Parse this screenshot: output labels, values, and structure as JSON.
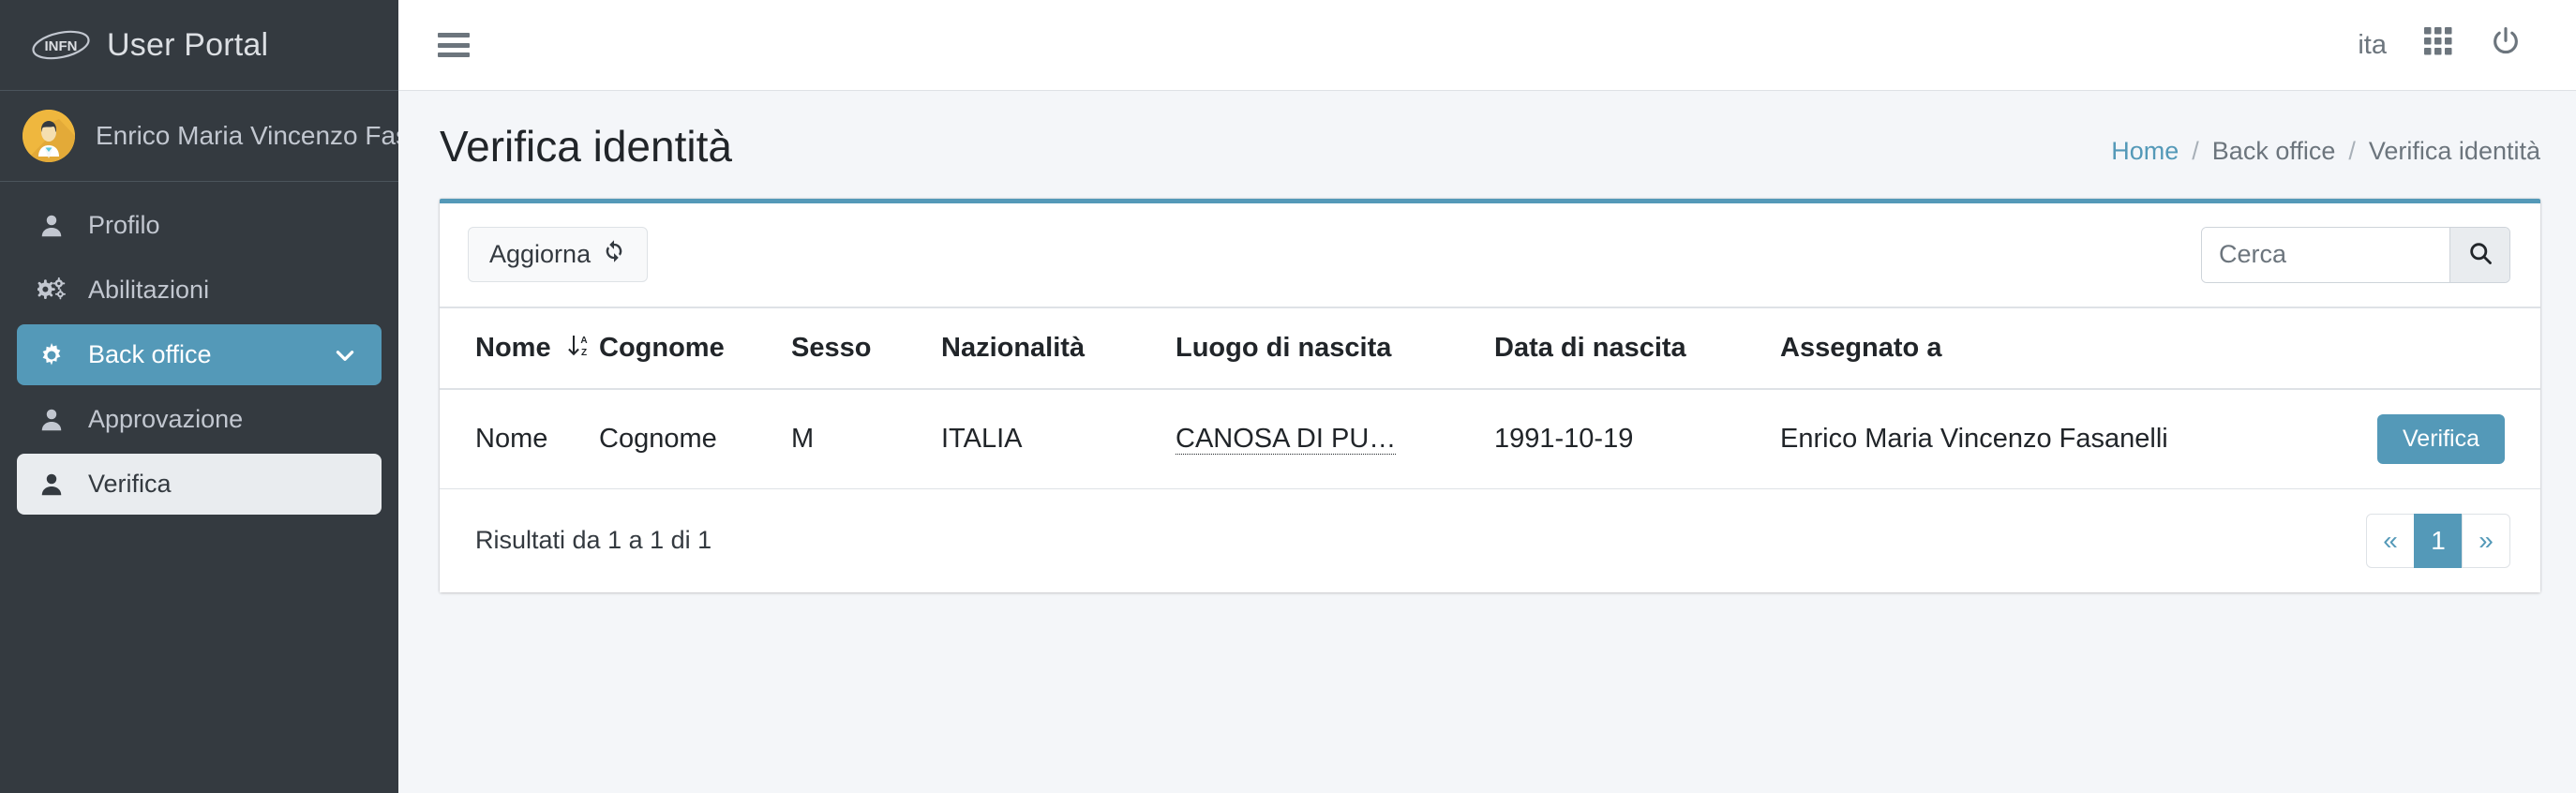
{
  "brand": {
    "logo_text": "INFN",
    "title": "User Portal"
  },
  "user": {
    "name": "Enrico Maria Vincenzo Fasanelli",
    "avatar_icon": "user-avatar"
  },
  "sidebar": {
    "items": [
      {
        "label": "Profilo",
        "icon": "user-icon",
        "state": "default"
      },
      {
        "label": "Abilitazioni",
        "icon": "gears-icon",
        "state": "default"
      },
      {
        "label": "Back office",
        "icon": "gear-icon",
        "state": "active",
        "chevron": "chevron-down-icon"
      },
      {
        "label": "Approvazione",
        "icon": "user-icon",
        "state": "default"
      },
      {
        "label": "Verifica",
        "icon": "user-icon",
        "state": "active-light"
      }
    ]
  },
  "topbar": {
    "menu_icon": "hamburger-icon",
    "language": "ita",
    "apps_icon": "grid-apps-icon",
    "power_icon": "power-icon"
  },
  "page": {
    "title": "Verifica identità",
    "breadcrumb": {
      "home": "Home",
      "section": "Back office",
      "current": "Verifica identità",
      "separator": "/"
    }
  },
  "card": {
    "refresh_label": "Aggiorna",
    "refresh_icon": "sync-icon",
    "search": {
      "placeholder": "Cerca",
      "value": "",
      "button_icon": "search-icon"
    },
    "table": {
      "columns": [
        {
          "label": "Nome",
          "sort_icon": "sort-alpha-down-icon",
          "sortable": true
        },
        {
          "label": "Cognome",
          "sortable": false
        },
        {
          "label": "Sesso",
          "sortable": false
        },
        {
          "label": "Nazionalità",
          "sortable": false
        },
        {
          "label": "Luogo di nascita",
          "sortable": false
        },
        {
          "label": "Data di nascita",
          "sortable": false
        },
        {
          "label": "Assegnato a",
          "sortable": false
        },
        {
          "label": "",
          "sortable": false
        }
      ],
      "rows": [
        {
          "nome": "Nome",
          "cognome": "Cognome",
          "sesso": "M",
          "nazionalita": "ITALIA",
          "luogo_di_nascita": "CANOSA DI PU…",
          "data_di_nascita": "1991-10-19",
          "assegnato_a": "Enrico Maria Vincenzo Fasanelli",
          "action_label": "Verifica"
        }
      ]
    },
    "footer": {
      "results_text": "Risultati da 1 a 1 di 1",
      "pagination": {
        "prev": "«",
        "next": "»",
        "pages": [
          "1"
        ],
        "current": "1"
      }
    }
  },
  "colors": {
    "sidebar_bg": "#343a40",
    "accent": "#5499b8",
    "content_bg": "#f4f6f9",
    "card_bg": "#ffffff",
    "avatar_bg": "#efb73e",
    "muted_text": "#6c757d"
  }
}
